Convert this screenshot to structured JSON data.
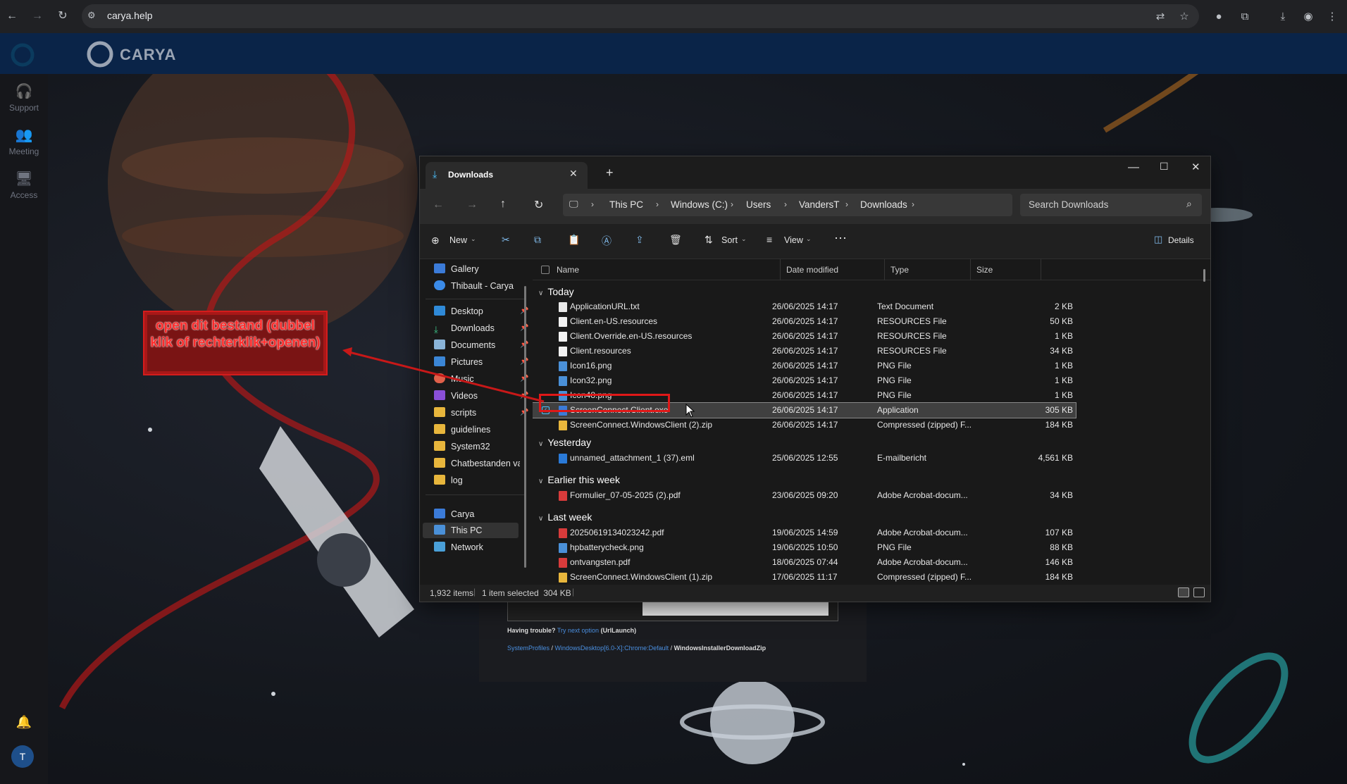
{
  "browser": {
    "url": "carya.help"
  },
  "app": {
    "brand": "CARYA",
    "rail": [
      {
        "label": "Support",
        "icon": "headset-icon"
      },
      {
        "label": "Meeting",
        "icon": "people-icon"
      },
      {
        "label": "Access",
        "icon": "monitor-icon"
      }
    ],
    "avatar_letter": "T"
  },
  "explorer": {
    "tab_title": "Downloads",
    "breadcrumb": [
      "This PC",
      "Windows (C:)",
      "Users",
      "VandersT",
      "Downloads"
    ],
    "search_placeholder": "Search Downloads",
    "commands": {
      "new": "New",
      "sort": "Sort",
      "view": "View",
      "details": "Details"
    },
    "nav": {
      "top": [
        "Gallery",
        "Thibault - Carya"
      ],
      "pinned": [
        "Desktop",
        "Downloads",
        "Documents",
        "Pictures",
        "Music",
        "Videos",
        "scripts"
      ],
      "folders": [
        "guidelines",
        "System32",
        "Chatbestanden va",
        "log"
      ],
      "bottom": [
        "Carya",
        "This PC",
        "Network"
      ]
    },
    "columns": {
      "name": "Name",
      "date": "Date modified",
      "type": "Type",
      "size": "Size"
    },
    "groups": [
      {
        "label": "Today",
        "files": [
          {
            "name": "ApplicationURL.txt",
            "date": "26/06/2025 14:17",
            "type": "Text Document",
            "size": "2 KB"
          },
          {
            "name": "Client.en-US.resources",
            "date": "26/06/2025 14:17",
            "type": "RESOURCES File",
            "size": "50 KB"
          },
          {
            "name": "Client.Override.en-US.resources",
            "date": "26/06/2025 14:17",
            "type": "RESOURCES File",
            "size": "1 KB"
          },
          {
            "name": "Client.resources",
            "date": "26/06/2025 14:17",
            "type": "RESOURCES File",
            "size": "34 KB"
          },
          {
            "name": "Icon16.png",
            "date": "26/06/2025 14:17",
            "type": "PNG File",
            "size": "1 KB"
          },
          {
            "name": "Icon32.png",
            "date": "26/06/2025 14:17",
            "type": "PNG File",
            "size": "1 KB"
          },
          {
            "name": "Icon48.png",
            "date": "26/06/2025 14:17",
            "type": "PNG File",
            "size": "1 KB"
          },
          {
            "name": "ScreenConnect.Client.exe",
            "date": "26/06/2025 14:17",
            "type": "Application",
            "size": "305 KB"
          },
          {
            "name": "ScreenConnect.WindowsClient (2).zip",
            "date": "26/06/2025 14:17",
            "type": "Compressed (zipped) F...",
            "size": "184 KB"
          }
        ]
      },
      {
        "label": "Yesterday",
        "files": [
          {
            "name": "unnamed_attachment_1 (37).eml",
            "date": "25/06/2025 12:55",
            "type": "E-mailbericht",
            "size": "4,561 KB"
          }
        ]
      },
      {
        "label": "Earlier this week",
        "files": [
          {
            "name": "Formulier_07-05-2025 (2).pdf",
            "date": "23/06/2025 09:20",
            "type": "Adobe Acrobat-docum...",
            "size": "34 KB"
          }
        ]
      },
      {
        "label": "Last week",
        "files": [
          {
            "name": "20250619134023242.pdf",
            "date": "19/06/2025 14:59",
            "type": "Adobe Acrobat-docum...",
            "size": "107 KB"
          },
          {
            "name": "hpbatterycheck.png",
            "date": "19/06/2025 10:50",
            "type": "PNG File",
            "size": "88 KB"
          },
          {
            "name": "ontvangsten.pdf",
            "date": "18/06/2025 07:44",
            "type": "Adobe Acrobat-docum...",
            "size": "146 KB"
          },
          {
            "name": "ScreenConnect.WindowsClient (1).zip",
            "date": "17/06/2025 11:17",
            "type": "Compressed (zipped) F...",
            "size": "184 KB"
          }
        ]
      }
    ],
    "status": {
      "items": "1,932 items",
      "selected": "1 item selected  304 KB"
    }
  },
  "annotation": {
    "text": "open dit bestand (dubbel klik of rechterklik+openen)"
  },
  "installer_panel": {
    "trouble": "Having trouble?",
    "try_next": "Try next option",
    "url_launch": "(UrlLaunch)",
    "path1": "SystemProfiles",
    "path2": "WindowsDesktop[6.0-X]:Chrome:Default",
    "path3": "WindowsInstallerDownloadZip"
  },
  "colors": {
    "header": "#0a2448",
    "accent": "#60a5fa",
    "annotation": "#e01818"
  }
}
